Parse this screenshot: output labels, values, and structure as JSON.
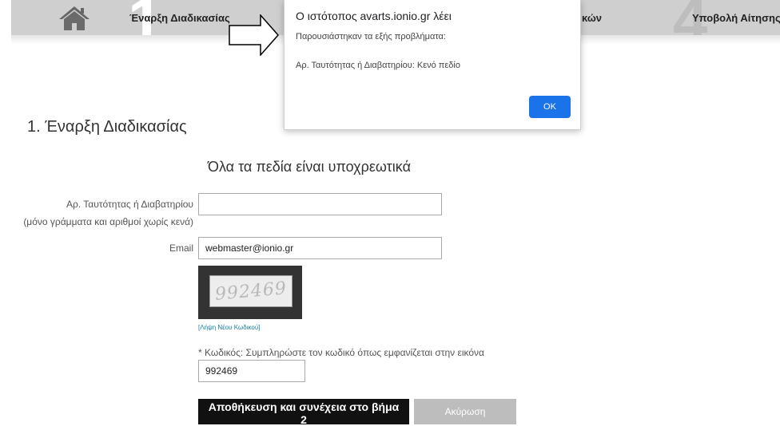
{
  "steps": {
    "step1_label": "Έναρξη Διαδικασίας",
    "step1_number": "1",
    "step3_label_partial": "κών",
    "step4_label": "Υποβολή Αίτησης",
    "step4_number": "4"
  },
  "alert": {
    "title": "Ο ιστότοπος avarts.ionio.gr λέει",
    "message_intro": "Παρουσιάστηκαν τα εξής προβλήματα:",
    "message_error": "Αρ. Ταυτότητας ή Διαβατηρίου: Κενό πεδίο",
    "ok_label": "OK",
    "ok_color": "#1a73e8"
  },
  "page": {
    "title": "1. Έναρξη Διαδικασίας",
    "subtitle": "Όλα τα πεδία είναι υποχρεωτικά"
  },
  "form": {
    "id_label": "Αρ. Ταυτότητας ή Διαβατηρίου",
    "id_hint": "(μόνο γράμματα και αριθμοί χωρίς κενά)",
    "id_value": "",
    "email_label": "Email",
    "email_value": "webmaster@ionio.gr",
    "captcha_image_text": "992469",
    "new_code_link": "[Λήψη Νέου Κωδικού]",
    "code_label": "* Κωδικός: Συμπληρώστε τον κωδικό όπως εμφανίζεται στην εικόνα",
    "code_value": "992469",
    "save_button": "Αποθήκευση και συνέχεια στο βήμα 2",
    "cancel_button": "Ακύρωση"
  },
  "icons": {
    "home": "home-icon",
    "arrow": "arrow-right-icon"
  }
}
